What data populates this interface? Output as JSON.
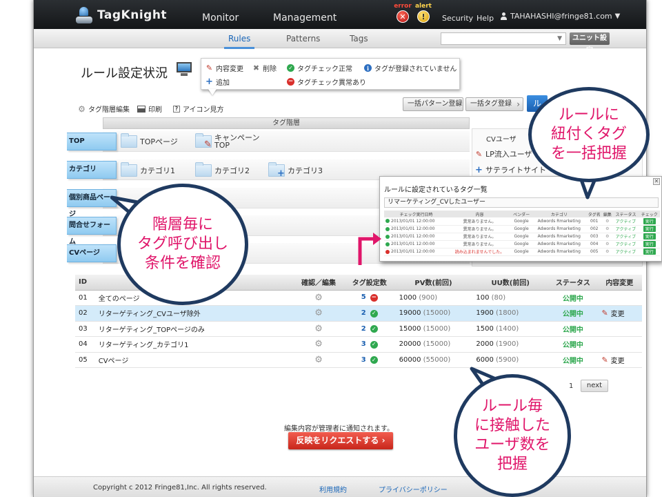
{
  "header": {
    "logo_text": "TagKnight",
    "nav": [
      "Monitor",
      "Management"
    ],
    "error_label": "error",
    "alert_label": "alert",
    "security": "Security",
    "help": "Help",
    "user": "TAHAHASHI@fringe81.com"
  },
  "subnav": {
    "tabs": [
      "Rules",
      "Patterns",
      "Tags"
    ],
    "unit_button": "ユニット設定"
  },
  "page": {
    "title": "ルール設定状況"
  },
  "legend": {
    "edit": "内容変更",
    "delete": "削除",
    "tag_ok": "タグチェック正常",
    "tag_unregistered": "タグが登録されていません",
    "add": "追加",
    "tag_error": "タグチェック異常あり"
  },
  "toolbar": {
    "hierarchy_edit": "タグ階層編集",
    "print": "印刷",
    "icon_help": "アイコン見方",
    "bulk_pattern": "一括パターン登録",
    "bulk_tag": "一括タグ登録"
  },
  "hierarchy": {
    "header": "タグ階層",
    "levels": [
      {
        "label": "TOP",
        "nodes": [
          "TOPページ",
          "キャンペーン\nTOP"
        ]
      },
      {
        "label": "カテゴリ",
        "nodes": [
          "カテゴリ1",
          "カテゴリ2",
          "カテゴリ3"
        ]
      },
      {
        "label": "個別商品ページ",
        "nodes": []
      },
      {
        "label": "問合せフォーム",
        "nodes": []
      },
      {
        "label": "CVページ",
        "nodes": []
      }
    ]
  },
  "cv_panel": {
    "title": "CVユーザ",
    "items": [
      "LP流入ユーザ",
      "サテライトサイト"
    ]
  },
  "tag_popup": {
    "title": "ルールに設定されているタグ一覧",
    "subtitle": "リマーケティング_CVしたユーザー",
    "columns": [
      "チェック実行日時",
      "内容",
      "ベンダー",
      "カテゴリ",
      "タグ名",
      "編集",
      "ステータス",
      "チェック"
    ],
    "rows": [
      {
        "ok": true,
        "date": "2013/01/01 12:00:00",
        "content": "異常ありません。",
        "vendor": "Google",
        "category": "Adwords Rmarketing",
        "tag": "001",
        "status": "アクティブ",
        "check": "実行"
      },
      {
        "ok": true,
        "date": "2013/01/01 12:00:00",
        "content": "異常ありません。",
        "vendor": "Google",
        "category": "Adwords Rmarketing",
        "tag": "002",
        "status": "アクティブ",
        "check": "実行"
      },
      {
        "ok": true,
        "date": "2013/01/01 12:00:00",
        "content": "異常ありません。",
        "vendor": "Google",
        "category": "Adwords Rmarketing",
        "tag": "003",
        "status": "アクティブ",
        "check": "実行"
      },
      {
        "ok": true,
        "date": "2013/01/01 12:00:00",
        "content": "異常ありません。",
        "vendor": "Google",
        "category": "Adwords Rmarketing",
        "tag": "004",
        "status": "アクティブ",
        "check": "実行"
      },
      {
        "ok": false,
        "date": "2013/01/01 12:00:00",
        "content": "読み込まれませんでした。",
        "vendor": "Google",
        "category": "Adwords Rmarketing",
        "tag": "005",
        "status": "アクティブ",
        "check": "実行"
      }
    ]
  },
  "table": {
    "columns": [
      "ID",
      "",
      "確認／編集",
      "タグ設定数",
      "PV数(前回)",
      "UU数(前回)",
      "ステータス",
      "内容変更"
    ],
    "rows": [
      {
        "id": "01",
        "name": "全てのページ",
        "tags": "5",
        "tag_ok": false,
        "pv": "1000",
        "pv_prev": "(900)",
        "uu": "100",
        "uu_prev": "(80)",
        "status": "公開中",
        "change": ""
      },
      {
        "id": "02",
        "name": "リターゲティング_CVユーザ除外",
        "tags": "2",
        "tag_ok": true,
        "pv": "19000",
        "pv_prev": "(15000)",
        "uu": "1900",
        "uu_prev": "(1800)",
        "status": "公開中",
        "change": "変更",
        "highlight": true
      },
      {
        "id": "03",
        "name": "リターゲティング_TOPページのみ",
        "tags": "2",
        "tag_ok": true,
        "pv": "15000",
        "pv_prev": "(15000)",
        "uu": "1500",
        "uu_prev": "(1400)",
        "status": "公開中",
        "change": ""
      },
      {
        "id": "04",
        "name": "リターゲティング_カテゴリ1",
        "tags": "3",
        "tag_ok": true,
        "pv": "20000",
        "pv_prev": "(15000)",
        "uu": "2000",
        "uu_prev": "(1900)",
        "status": "公開中",
        "change": ""
      },
      {
        "id": "05",
        "name": "CVページ",
        "tags": "3",
        "tag_ok": true,
        "pv": "60000",
        "pv_prev": "(55000)",
        "uu": "6000",
        "uu_prev": "(5900)",
        "status": "公開中",
        "change": "変更"
      }
    ]
  },
  "pagination": {
    "page": "1",
    "next": "next"
  },
  "bottom": {
    "notice": "編集内容が管理者に通知されます。",
    "request_button": "反映をリクエストする"
  },
  "footer": {
    "copyright": "Copyright c 2012 Fringe81,Inc. All rights reserved.",
    "terms": "利用規約",
    "privacy": "プライバシーポリシー"
  },
  "callouts": {
    "left": [
      "階層毎に",
      "タグ呼び出し",
      "条件を確認"
    ],
    "right_top": [
      "ルールに",
      "紐付くタグ",
      "を一括把握"
    ],
    "right_bottom": [
      "ルール毎",
      "に接触した",
      "ユーザ数を",
      "把握"
    ]
  },
  "colors": {
    "callout_text": "#e0166a",
    "callout_border": "#1f3a60",
    "accent_blue": "#1a66b8",
    "ok_green": "#2fa84f",
    "error_red": "#d9302c",
    "highlight_row": "#d4ebfa"
  }
}
